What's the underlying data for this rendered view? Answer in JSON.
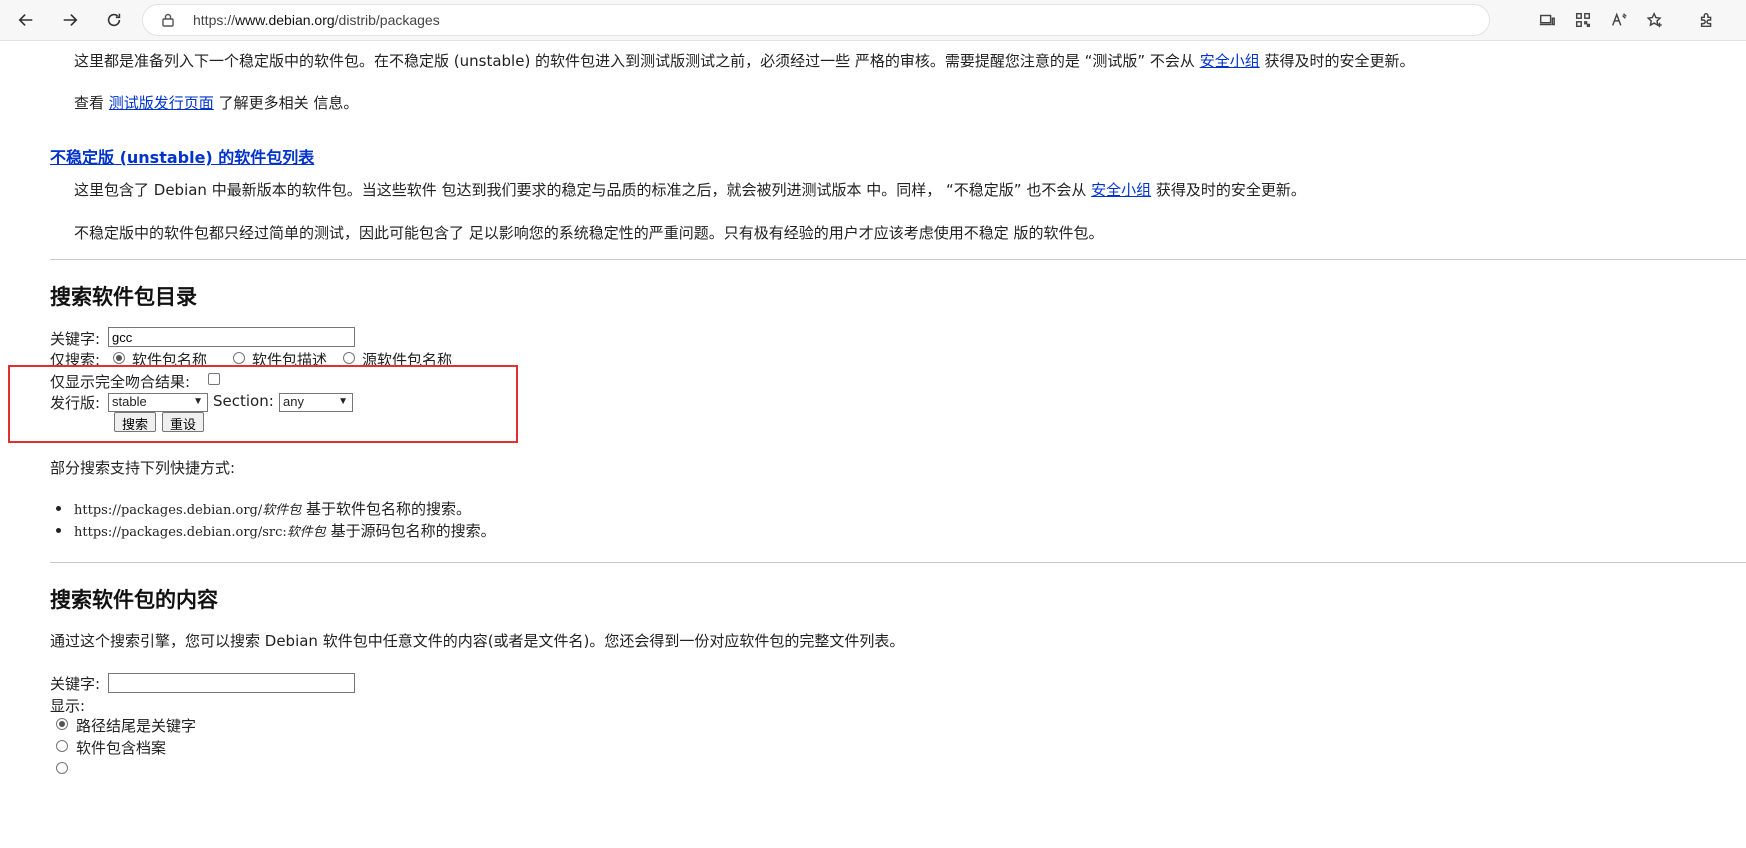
{
  "browser": {
    "url_prefix": "https://",
    "url_host": "www.debian.org",
    "url_path": "/distrib/packages"
  },
  "testing": {
    "para1_a": "这里都是准备列入下一个稳定版中的软件包。在不稳定版 (unstable) 的软件包进入到测试版测试之前，必须经过一些 严格的审核。需要提醒您注意的是 “测试版” 不会从 ",
    "para1_link": "安全小组",
    "para1_b": " 获得及时的安全更新。",
    "para2_a": "查看 ",
    "para2_link": "测试版发行页面",
    "para2_b": " 了解更多相关 信息。"
  },
  "unstable": {
    "heading": "不稳定版 (unstable) 的软件包列表",
    "para1_a": "这里包含了 Debian 中最新版本的软件包。当这些软件 包达到我们要求的稳定与品质的标准之后，就会被列进测试版本 中。同样， “不稳定版” 也不会从 ",
    "para1_link": "安全小组",
    "para1_b": " 获得及时的安全更新。",
    "para2": "不稳定版中的软件包都只经过简单的测试，因此可能包含了 足以影响您的系统稳定性的严重问题。只有极有经验的用户才应该考虑使用不稳定 版的软件包。"
  },
  "search_dir": {
    "heading": "搜索软件包目录",
    "keyword_label": "关键字:",
    "keyword_value": "gcc",
    "only_label": "仅搜索:",
    "radio_names": "软件包名称",
    "radio_desc": "软件包描述",
    "radio_src": "源软件包名称",
    "exact_label": "仅显示完全吻合结果:",
    "release_label": "发行版:",
    "release_value": "stable",
    "section_label": "Section:",
    "section_value": "any",
    "search_btn": "搜索",
    "reset_btn": "重设",
    "shortcuts_intro": "部分搜索支持下列快捷方式:",
    "sc1_url": "https://packages.debian.org/",
    "sc1_var": "软件包",
    "sc1_desc": " 基于软件包名称的搜索。",
    "sc2_url": "https://packages.debian.org/src:",
    "sc2_var": "软件包",
    "sc2_desc": " 基于源码包名称的搜索。"
  },
  "search_content": {
    "heading": "搜索软件包的内容",
    "intro": "通过这个搜索引擎，您可以搜索 Debian 软件包中任意文件的内容(或者是文件名)。您还会得到一份对应软件包的完整文件列表。",
    "keyword_label": "关键字:",
    "keyword_value": "",
    "display_label": "显示:",
    "opt1": "路径结尾是关键字",
    "opt2": "软件包含档案"
  }
}
